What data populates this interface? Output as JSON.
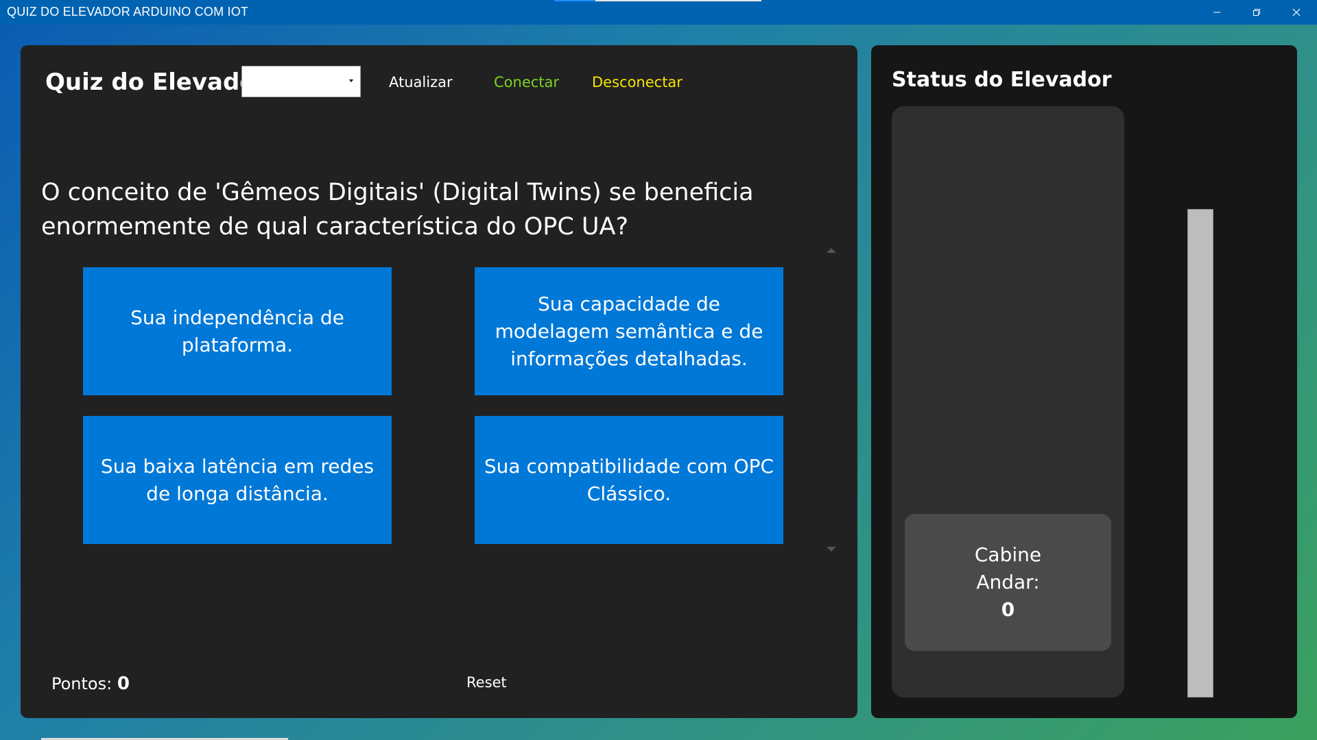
{
  "window": {
    "title": "QUIZ DO ELEVADOR ARDUINO COM IOT",
    "controls": [
      "minimize-icon",
      "restore-icon",
      "close-icon"
    ],
    "titlebar_color": "#0063b1"
  },
  "quiz": {
    "title": "Quiz do Elevador",
    "select_value": "",
    "toolbar": {
      "atualizar": "Atualizar",
      "conectar": "Conectar",
      "desconectar": "Desconectar"
    },
    "question": "O conceito de 'Gêmeos Digitais' (Digital Twins) se beneficia enormemente de qual característica do OPC UA?",
    "answers": [
      "Sua independência de plataforma.",
      "Sua capacidade de modelagem semântica e de informações detalhadas.",
      "Sua baixa latência em redes de longa distância.",
      "Sua compatibilidade com OPC Clássico."
    ],
    "score_label": "Pontos:",
    "score_value": "0",
    "reset_label": "Reset",
    "colors": {
      "answer_bg": "#0078d7",
      "conectar": "#7ed321",
      "desconectar": "#f5e400",
      "panel_bg": "#212121"
    }
  },
  "status": {
    "title": "Status do Elevador",
    "cabin_label": "Cabine",
    "floor_label": "Andar:",
    "floor_value": "0"
  }
}
